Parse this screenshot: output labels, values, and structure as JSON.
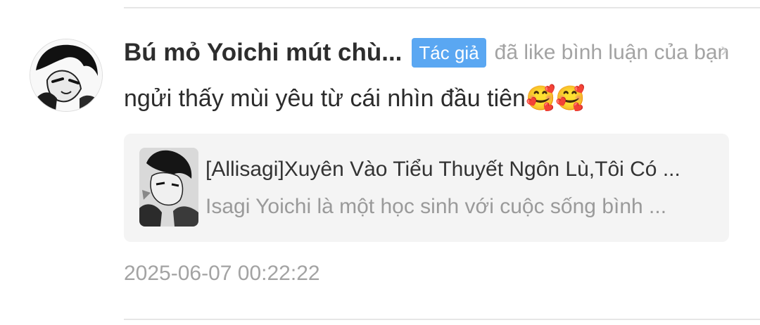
{
  "notification": {
    "username": "Bú mỏ Yoichi mút chù...",
    "badge": "Tác giả",
    "action": "đã like bình luận của bạn",
    "comment_text": "ngửi thấy mùi yêu từ cái nhìn đầu tiên🥰🥰",
    "timestamp": "2025-06-07 00:22:22",
    "chevron": "›"
  },
  "story_card": {
    "title": "[Allisagi]Xuyên Vào Tiểu Thuyết Ngôn Lù,Tôi Có ...",
    "description": "Isagi Yoichi là một học sinh với cuộc sống bình ..."
  },
  "icons": {
    "avatar": "manga-avatar",
    "cover": "story-cover-image",
    "chevron": "chevron-right-icon"
  }
}
